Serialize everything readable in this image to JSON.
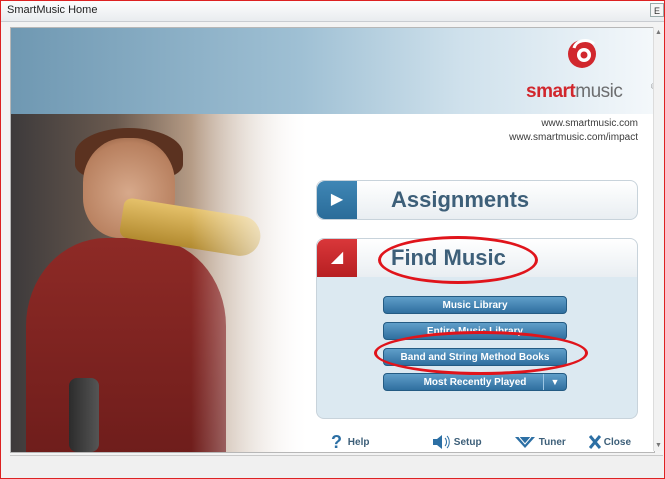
{
  "window": {
    "title": "SmartMusic Home",
    "title_button": "E"
  },
  "brand": {
    "logo_smart": "smart",
    "logo_music": "music",
    "registered": "®",
    "url_primary": "www.smartmusic.com",
    "url_secondary": "www.smartmusic.com/impact",
    "brand_red": "#d1272d",
    "brand_blue": "#2f6f9f"
  },
  "panels": {
    "assignments": {
      "label": "Assignments",
      "state": "collapsed",
      "icon": "play-right-icon"
    },
    "find_music": {
      "label": "Find Music",
      "state": "expanded",
      "icon": "triangle-down-icon",
      "buttons": [
        {
          "label": "Music Library"
        },
        {
          "label": "Entire Music Library"
        },
        {
          "label": "Band and String Method Books"
        },
        {
          "label": "Most Recently Played",
          "has_dropdown": true
        }
      ]
    }
  },
  "footer": {
    "help": "Help",
    "setup": "Setup",
    "tuner": "Tuner",
    "close": "Close"
  },
  "annotations": {
    "circled": [
      "Find Music",
      "Band and String Method Books"
    ],
    "color": "#e0141b"
  }
}
